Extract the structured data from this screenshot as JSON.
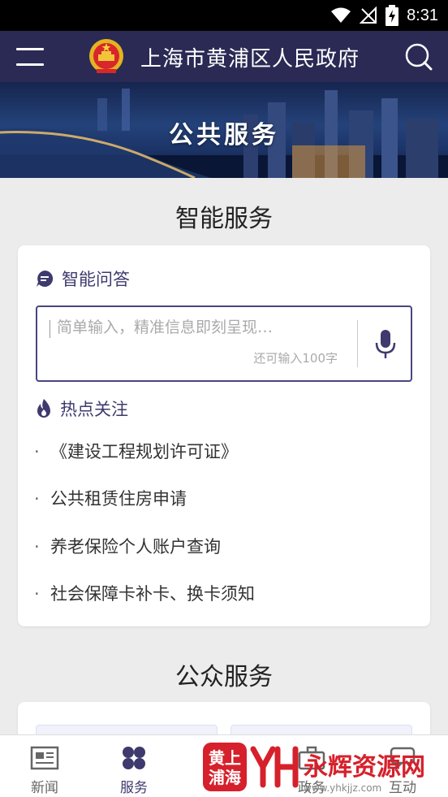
{
  "status_bar": {
    "time": "8:31",
    "icons": [
      "wifi-icon",
      "signal-icon",
      "battery-charging-icon"
    ]
  },
  "app_bar": {
    "title": "上海市黄浦区人民政府",
    "menu_icon": "hamburger-menu-icon",
    "search_icon": "search-icon",
    "emblem_icon": "national-emblem-icon"
  },
  "banner": {
    "title": "公共服务"
  },
  "smart_service": {
    "title": "智能服务",
    "qa": {
      "heading": "智能问答",
      "icon": "chat-bubble-icon",
      "placeholder": "简单输入，精准信息即刻呈现…",
      "value": "",
      "char_hint": "还可输入100字",
      "mic_icon": "microphone-icon"
    },
    "hot": {
      "heading": "热点关注",
      "icon": "flame-icon",
      "bullet": "·",
      "items": [
        "《建设工程规划许可证》",
        "公共租赁住房申请",
        "养老保险个人账户查询",
        "社会保障卡补卡、换卡须知"
      ]
    }
  },
  "public_service": {
    "title": "公众服务"
  },
  "tab_bar": {
    "active": "服务",
    "tabs": [
      {
        "label": "新闻",
        "icon": "newspaper-icon"
      },
      {
        "label": "服务",
        "icon": "four-petal-icon"
      },
      {
        "label": "政务",
        "icon": "briefcase-icon"
      },
      {
        "label": "互动",
        "icon": "chat-icon"
      }
    ]
  },
  "watermark": {
    "logo_text": "黄上浦海",
    "brand": "永辉资源网",
    "url": "www.yhkjjz.com"
  },
  "colors": {
    "primary": "#2a2a55",
    "accent": "#3e3a6e",
    "background": "#ececec",
    "watermark_red": "#d6202b"
  }
}
